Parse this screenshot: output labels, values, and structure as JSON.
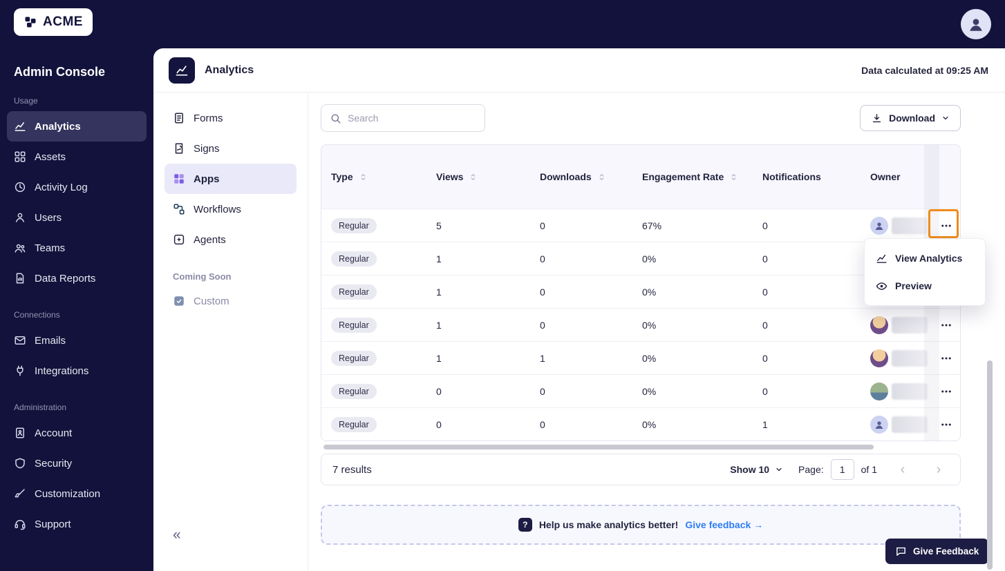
{
  "brand": {
    "name": "ACME"
  },
  "sidebar": {
    "title": "Admin Console",
    "sections": [
      {
        "label": "Usage",
        "items": [
          {
            "label": "Analytics",
            "icon": "analytics",
            "active": true
          },
          {
            "label": "Assets",
            "icon": "assets"
          },
          {
            "label": "Activity Log",
            "icon": "activity-log"
          },
          {
            "label": "Users",
            "icon": "users"
          },
          {
            "label": "Teams",
            "icon": "teams"
          },
          {
            "label": "Data Reports",
            "icon": "data-reports"
          }
        ]
      },
      {
        "label": "Connections",
        "items": [
          {
            "label": "Emails",
            "icon": "emails"
          },
          {
            "label": "Integrations",
            "icon": "integrations"
          }
        ]
      },
      {
        "label": "Administration",
        "items": [
          {
            "label": "Account",
            "icon": "account"
          },
          {
            "label": "Security",
            "icon": "security"
          },
          {
            "label": "Customization",
            "icon": "customization"
          },
          {
            "label": "Support",
            "icon": "support"
          }
        ]
      }
    ]
  },
  "app_header": {
    "title": "Analytics",
    "calculated": "Data calculated at 09:25 AM"
  },
  "subnav": {
    "items": [
      {
        "label": "Forms",
        "icon": "forms"
      },
      {
        "label": "Signs",
        "icon": "signs"
      },
      {
        "label": "Apps",
        "icon": "apps",
        "active": true
      },
      {
        "label": "Workflows",
        "icon": "workflows"
      },
      {
        "label": "Agents",
        "icon": "agents"
      }
    ],
    "coming_soon_label": "Coming Soon",
    "custom_label": "Custom"
  },
  "toolbar": {
    "search_placeholder": "Search",
    "download_label": "Download"
  },
  "table": {
    "columns": [
      {
        "label": "Type",
        "sortable": true
      },
      {
        "label": "Views",
        "sortable": true
      },
      {
        "label": "Downloads",
        "sortable": true
      },
      {
        "label": "Engagement Rate",
        "sortable": true
      },
      {
        "label": "Notifications",
        "sortable": false
      },
      {
        "label": "Owner",
        "sortable": false
      }
    ],
    "rows": [
      {
        "type": "Regular",
        "views": "5",
        "downloads": "0",
        "engagement": "67%",
        "notifications": "0",
        "avatar": "person"
      },
      {
        "type": "Regular",
        "views": "1",
        "downloads": "0",
        "engagement": "0%",
        "notifications": "0",
        "avatar": "person"
      },
      {
        "type": "Regular",
        "views": "1",
        "downloads": "0",
        "engagement": "0%",
        "notifications": "0",
        "avatar": "person"
      },
      {
        "type": "Regular",
        "views": "1",
        "downloads": "0",
        "engagement": "0%",
        "notifications": "0",
        "avatar": "photo"
      },
      {
        "type": "Regular",
        "views": "1",
        "downloads": "1",
        "engagement": "0%",
        "notifications": "0",
        "avatar": "photo"
      },
      {
        "type": "Regular",
        "views": "0",
        "downloads": "0",
        "engagement": "0%",
        "notifications": "0",
        "avatar": "photo2"
      },
      {
        "type": "Regular",
        "views": "0",
        "downloads": "0",
        "engagement": "0%",
        "notifications": "1",
        "avatar": "person"
      }
    ]
  },
  "row_menu": {
    "items": [
      {
        "label": "View Analytics",
        "icon": "chart"
      },
      {
        "label": "Preview",
        "icon": "eye"
      }
    ]
  },
  "pagination": {
    "results_label": "7 results",
    "show_label": "Show 10",
    "page_label": "Page:",
    "page_value": "1",
    "of_label": "of 1"
  },
  "banner": {
    "message": "Help us make analytics better!",
    "link_label": "Give feedback →"
  },
  "feedback": {
    "label": "Give Feedback"
  },
  "icons": {
    "chevron_left": "‹",
    "chevron_right": "›",
    "collapse": "«",
    "help": "?"
  },
  "colors": {
    "navy": "#12123c",
    "sidebar_active": "#34345e",
    "subnav_active": "#e9e9f9",
    "accent_purple": "#7c5ce8",
    "highlight_orange": "#ef8c1d",
    "link_blue": "#2e7cf6",
    "header_bg": "#f7f7fd"
  }
}
